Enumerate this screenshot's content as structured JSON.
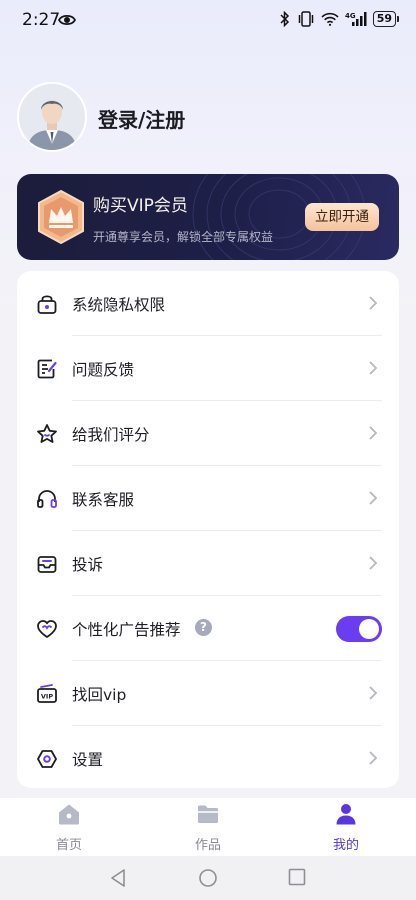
{
  "status_bar": {
    "time": "2:27",
    "battery": "59",
    "network": "4G",
    "icons": [
      "eye-icon",
      "bluetooth-icon",
      "vibrate-icon",
      "wifi-icon",
      "signal-icon",
      "battery-icon"
    ]
  },
  "profile": {
    "login_label": "登录/注册",
    "avatar_icon": "user-avatar-icon"
  },
  "vip": {
    "title": "购买VIP会员",
    "subtitle": "开通尊享会员，解锁全部专属权益",
    "button_label": "立即开通",
    "badge_icon": "crown-badge-icon",
    "colors": {
      "card": "#1e1f48",
      "button": "#f3c39c"
    }
  },
  "menu": {
    "items": [
      {
        "label": "系统隐私权限",
        "icon": "lock-icon"
      },
      {
        "label": "问题反馈",
        "icon": "edit-note-icon"
      },
      {
        "label": "给我们评分",
        "icon": "star-icon"
      },
      {
        "label": "联系客服",
        "icon": "headphones-icon"
      },
      {
        "label": "投诉",
        "icon": "mailbox-icon"
      },
      {
        "label": "个性化广告推荐",
        "icon": "heart-icon",
        "help": "?",
        "toggle_on": true
      },
      {
        "label": "找回vip",
        "icon": "vip-card-icon",
        "vip_text": "VIP"
      },
      {
        "label": "设置",
        "icon": "settings-hexagon-icon"
      }
    ]
  },
  "bottom_nav": {
    "tabs": [
      {
        "label": "首页",
        "icon": "home-icon",
        "active": false
      },
      {
        "label": "作品",
        "icon": "folder-icon",
        "active": false
      },
      {
        "label": "我的",
        "icon": "person-icon",
        "active": true
      }
    ],
    "accent_color": "#5a35e0"
  },
  "system_nav": [
    "back-icon",
    "home-circle-icon",
    "recents-icon"
  ]
}
